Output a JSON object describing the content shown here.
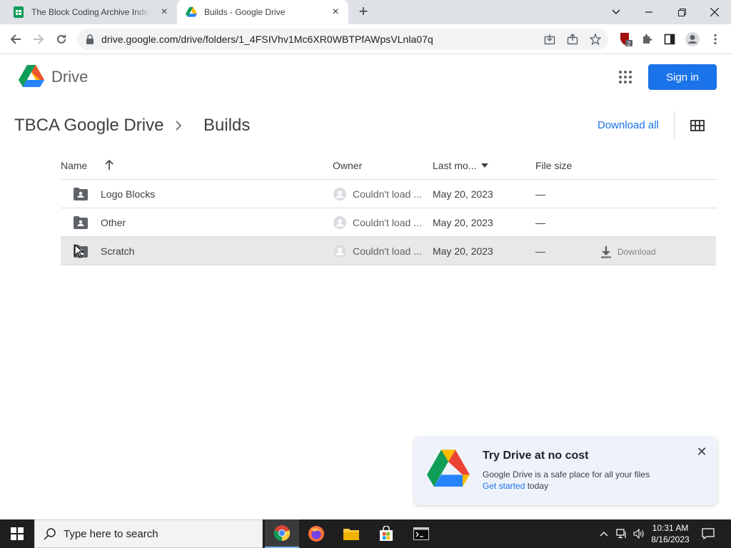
{
  "browser": {
    "tabs": [
      {
        "title": "The Block Coding Archive Index",
        "favicon": "sheets-icon",
        "active": false
      },
      {
        "title": "Builds - Google Drive",
        "favicon": "drive-icon",
        "active": true
      }
    ],
    "url": "drive.google.com/drive/folders/1_4FSIVhv1Mc6XR0WBTPfAWpsVLnla07q",
    "extension_badge": "2"
  },
  "drive": {
    "logo_text": "Drive",
    "sign_in_label": "Sign in",
    "breadcrumb": {
      "root": "TBCA Google Drive",
      "current": "Builds"
    },
    "download_all_label": "Download all",
    "columns": {
      "name": "Name",
      "owner": "Owner",
      "modified": "Last mo...",
      "size": "File size"
    },
    "rows": [
      {
        "name": "Logo Blocks",
        "owner": "Couldn't load ...",
        "modified": "May 20, 2023",
        "size": "—"
      },
      {
        "name": "Other",
        "owner": "Couldn't load ...",
        "modified": "May 20, 2023",
        "size": "—"
      },
      {
        "name": "Scratch",
        "owner": "Couldn't load ...",
        "modified": "May 20, 2023",
        "size": "—",
        "action": "Download"
      }
    ],
    "promo": {
      "title": "Try Drive at no cost",
      "body": "Google Drive is a safe place for all your files",
      "link": "Get started",
      "tail": " today"
    }
  },
  "taskbar": {
    "search_placeholder": "Type here to search",
    "time": "10:31 AM",
    "date": "8/16/2023"
  },
  "colors": {
    "accent": "#1a73e8",
    "hover_row": "#e8e8e8",
    "promo_bg": "#eef3fb"
  }
}
